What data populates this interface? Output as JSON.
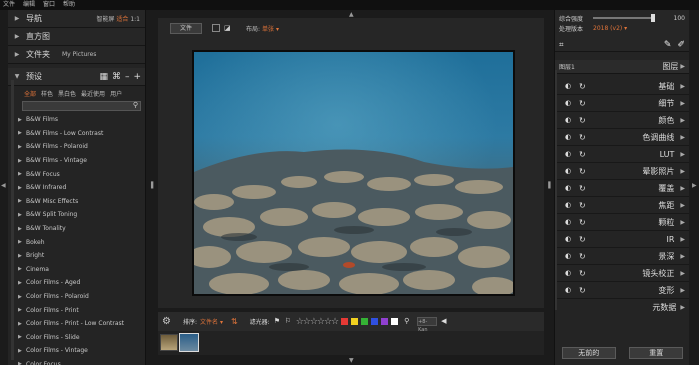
{
  "menubar": {
    "items": [
      "文件",
      "编辑",
      "窗口",
      "帮助"
    ]
  },
  "left": {
    "nav": {
      "label": "导航",
      "options": [
        "智能屏",
        "适合",
        "1:1"
      ],
      "active_index": 1
    },
    "histogram": {
      "label": "直方图"
    },
    "folder": {
      "label": "文件夹",
      "value": "My Pictures"
    },
    "presets": {
      "label": "预设",
      "icons": [
        "grid-icon",
        "shuffle-icon",
        "minus-icon",
        "plus-icon"
      ],
      "tabs": [
        "全部",
        "样色",
        "黑白色",
        "最近使用",
        "用户"
      ],
      "active_tab": 0,
      "search_placeholder": "",
      "items": [
        "B&W Films",
        "B&W Films - Low Contrast",
        "B&W Films - Polaroid",
        "B&W Films - Vintage",
        "B&W Focus",
        "B&W Infrared",
        "B&W Misc Effects",
        "B&W Split Toning",
        "B&W Tonality",
        "Bokeh",
        "Bright",
        "Cinema",
        "Color Films - Aged",
        "Color Films - Polaroid",
        "Color Films - Print",
        "Color Films - Print - Low Contrast",
        "Color Films - Slide",
        "Color Films - Vintage",
        "Color Focus"
      ]
    }
  },
  "center": {
    "file_button": "文件",
    "layout_label": "布局:",
    "layout_value": "单张",
    "bottom": {
      "sort_label": "排序:",
      "sort_value": "文件名",
      "filter_label": "滤光器:",
      "swatches": [
        "#e53935",
        "#f0d020",
        "#35b335",
        "#3050e0",
        "#9040d0",
        "#ffffff"
      ],
      "filter_box": "+8-Kan"
    },
    "filmstrip": {
      "count": 2
    }
  },
  "right": {
    "strength_label": "综合强度",
    "strength_value": "100",
    "process_label": "处理版本",
    "process_value": "2018 (v2)",
    "layer_label": "图层1",
    "layer_header": "图层",
    "modules": [
      "基础",
      "细节",
      "颜色",
      "色调曲线",
      "LUT",
      "晕影照片",
      "覆盖",
      "焦距",
      "颗粒",
      "IR",
      "景深",
      "镜头校正",
      "变形"
    ],
    "metadata": "元数据",
    "buttons": [
      "无前的",
      "重置"
    ]
  }
}
